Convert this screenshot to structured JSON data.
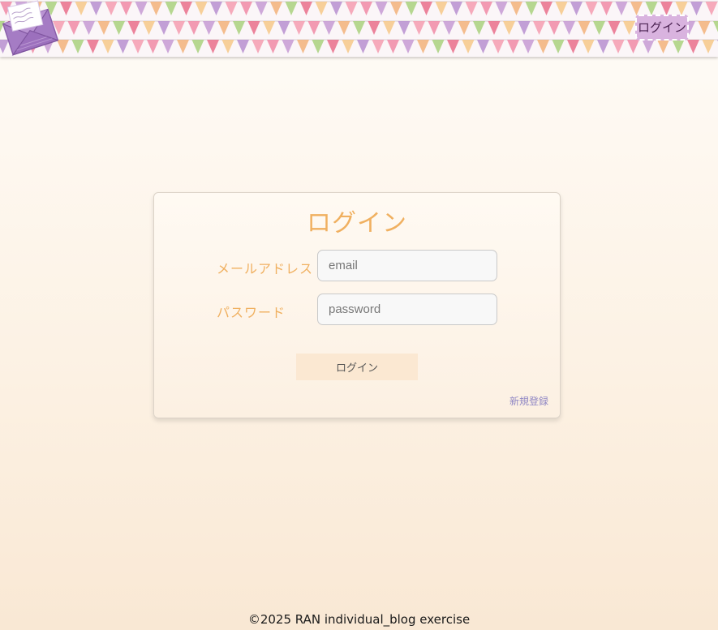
{
  "header": {
    "login_label": "ログイン",
    "pennant_colors": [
      "#f08aa6",
      "#c59ad4",
      "#f2b27a",
      "#a9d17e",
      "#e96f8b",
      "#f6c888",
      "#b78fd0",
      "#f59cb0"
    ]
  },
  "login_form": {
    "title": "ログイン",
    "email_label": "メールアドレス",
    "email_placeholder": "email",
    "password_label": "パスワード",
    "password_placeholder": "password",
    "submit_label": "ログイン",
    "register_link": "新規登録"
  },
  "footer": {
    "copyright": "©2025 RAN individual_blog exercise"
  },
  "colors": {
    "accent": "#f0b060",
    "header_button": "#d9b3df",
    "link": "#8f86c4"
  }
}
